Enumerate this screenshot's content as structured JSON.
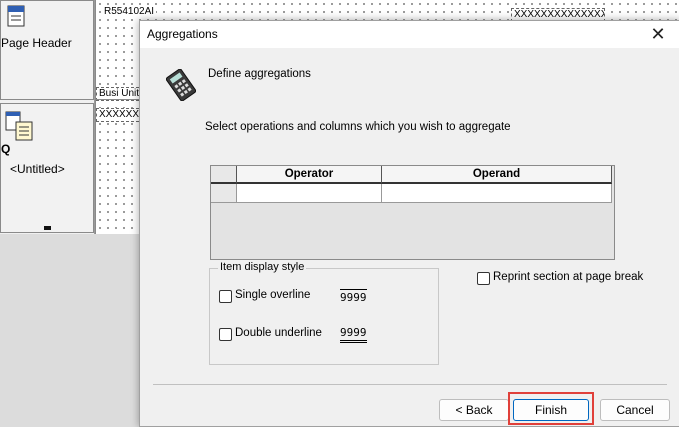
{
  "background": {
    "page_header_label": "Page Header",
    "section_label": "<Untitled>",
    "section_short": "Q",
    "field_top_left": "R554102AI",
    "field_top_right": "XXXXXXXXXXXXXXXXX",
    "field_busi_unit": "Busi Unit",
    "field_row": "XXXXXXXXX"
  },
  "dialog": {
    "title": "Aggregations",
    "close_glyph": "✕",
    "heading": "Define aggregations",
    "instruction": "Select operations and columns which you wish to aggregate",
    "grid": {
      "columns": [
        "Operator",
        "Operand"
      ],
      "rows": [
        [
          "",
          ""
        ]
      ]
    },
    "item_display_style": {
      "title": "Item display style",
      "options": [
        {
          "label": "Single overline",
          "sample": "9999",
          "checked": false
        },
        {
          "label": "Double underline",
          "sample": "9999",
          "checked": false
        }
      ]
    },
    "reprint_label": "Reprint section at page break",
    "reprint_checked": false,
    "buttons": {
      "back": "< Back",
      "finish": "Finish",
      "cancel": "Cancel"
    },
    "highlight_color": "#e0403a"
  }
}
